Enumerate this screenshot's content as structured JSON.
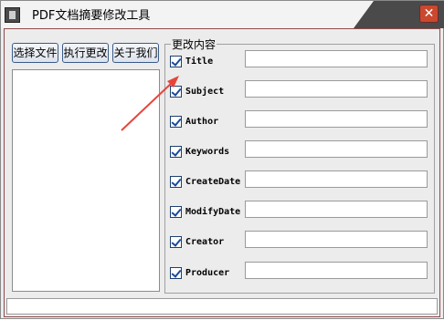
{
  "window": {
    "title": "PDF文档摘要修改工具"
  },
  "buttons": {
    "select": "选择文件",
    "execute": "执行更改",
    "about": "关于我们"
  },
  "group": {
    "legend": "更改内容"
  },
  "fields": [
    {
      "label": "Title",
      "checked": true,
      "value": ""
    },
    {
      "label": "Subject",
      "checked": true,
      "value": ""
    },
    {
      "label": "Author",
      "checked": true,
      "value": ""
    },
    {
      "label": "Keywords",
      "checked": true,
      "value": ""
    },
    {
      "label": "CreateDate",
      "checked": true,
      "value": ""
    },
    {
      "label": "ModifyDate",
      "checked": true,
      "value": ""
    },
    {
      "label": "Creator",
      "checked": true,
      "value": ""
    },
    {
      "label": "Producer",
      "checked": true,
      "value": ""
    }
  ],
  "annotation": {
    "arrow_color": "#e8453a"
  },
  "close_glyph": "✕"
}
